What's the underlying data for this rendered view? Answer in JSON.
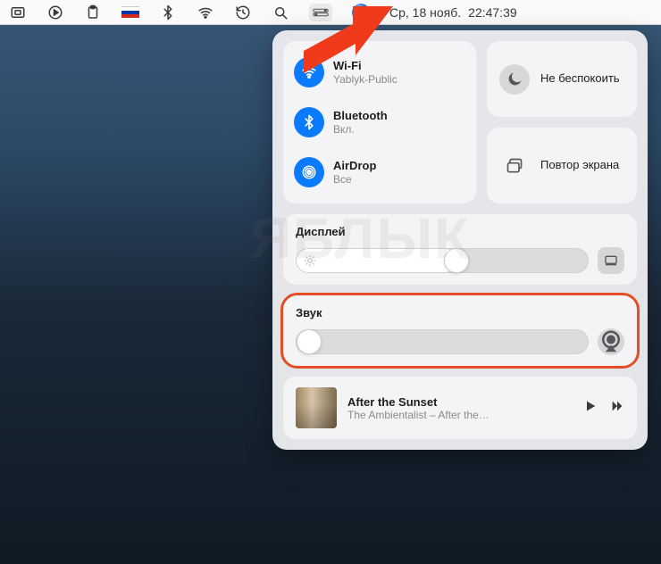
{
  "menubar": {
    "date": "Ср, 18 нояб.",
    "time": "22:47:39"
  },
  "cc": {
    "wifi": {
      "label": "Wi-Fi",
      "status": "Yablyk-Public"
    },
    "bluetooth": {
      "label": "Bluetooth",
      "status": "Вкл."
    },
    "airdrop": {
      "label": "AirDrop",
      "status": "Все"
    },
    "dnd": {
      "label": "Не беспокоить"
    },
    "mirror": {
      "label": "Повтор экрана"
    },
    "display": {
      "label": "Дисплей",
      "level": 55
    },
    "sound": {
      "label": "Звук",
      "level": 0
    },
    "now_playing": {
      "title": "After the Sunset",
      "subtitle": "The Ambientalist – After the…"
    }
  },
  "watermark": "ЯБЛЫК"
}
